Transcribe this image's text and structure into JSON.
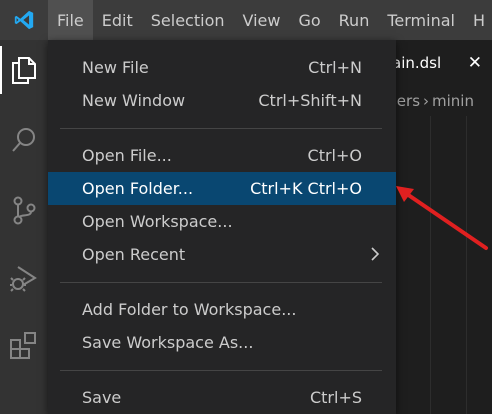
{
  "menubar": {
    "items": [
      "File",
      "Edit",
      "Selection",
      "View",
      "Go",
      "Run",
      "Terminal",
      "H"
    ],
    "active": "File"
  },
  "activity_bar": {
    "icons": [
      "explorer-icon",
      "search-icon",
      "source-control-icon",
      "run-debug-icon",
      "extensions-icon"
    ]
  },
  "editor": {
    "tab_label": "ain.dsl",
    "tab_close": "✕",
    "breadcrumb": [
      "Users",
      "minin"
    ]
  },
  "file_menu": {
    "groups": [
      [
        {
          "label": "New File",
          "shortcut": "Ctrl+N"
        },
        {
          "label": "New Window",
          "shortcut": "Ctrl+Shift+N"
        }
      ],
      [
        {
          "label": "Open File...",
          "shortcut": "Ctrl+O"
        },
        {
          "label": "Open Folder...",
          "shortcut": "Ctrl+K Ctrl+O",
          "highlighted": true
        },
        {
          "label": "Open Workspace...",
          "shortcut": ""
        },
        {
          "label": "Open Recent",
          "shortcut": "",
          "submenu": true
        }
      ],
      [
        {
          "label": "Add Folder to Workspace...",
          "shortcut": ""
        },
        {
          "label": "Save Workspace As...",
          "shortcut": ""
        }
      ],
      [
        {
          "label": "Save",
          "shortcut": "Ctrl+S"
        }
      ]
    ]
  },
  "colors": {
    "menubar_bg": "#3c3c3c",
    "menu_bg": "#252526",
    "highlight_bg": "#094771",
    "annotation_arrow": "#e02020",
    "logo_blue": "#23a9f2"
  }
}
